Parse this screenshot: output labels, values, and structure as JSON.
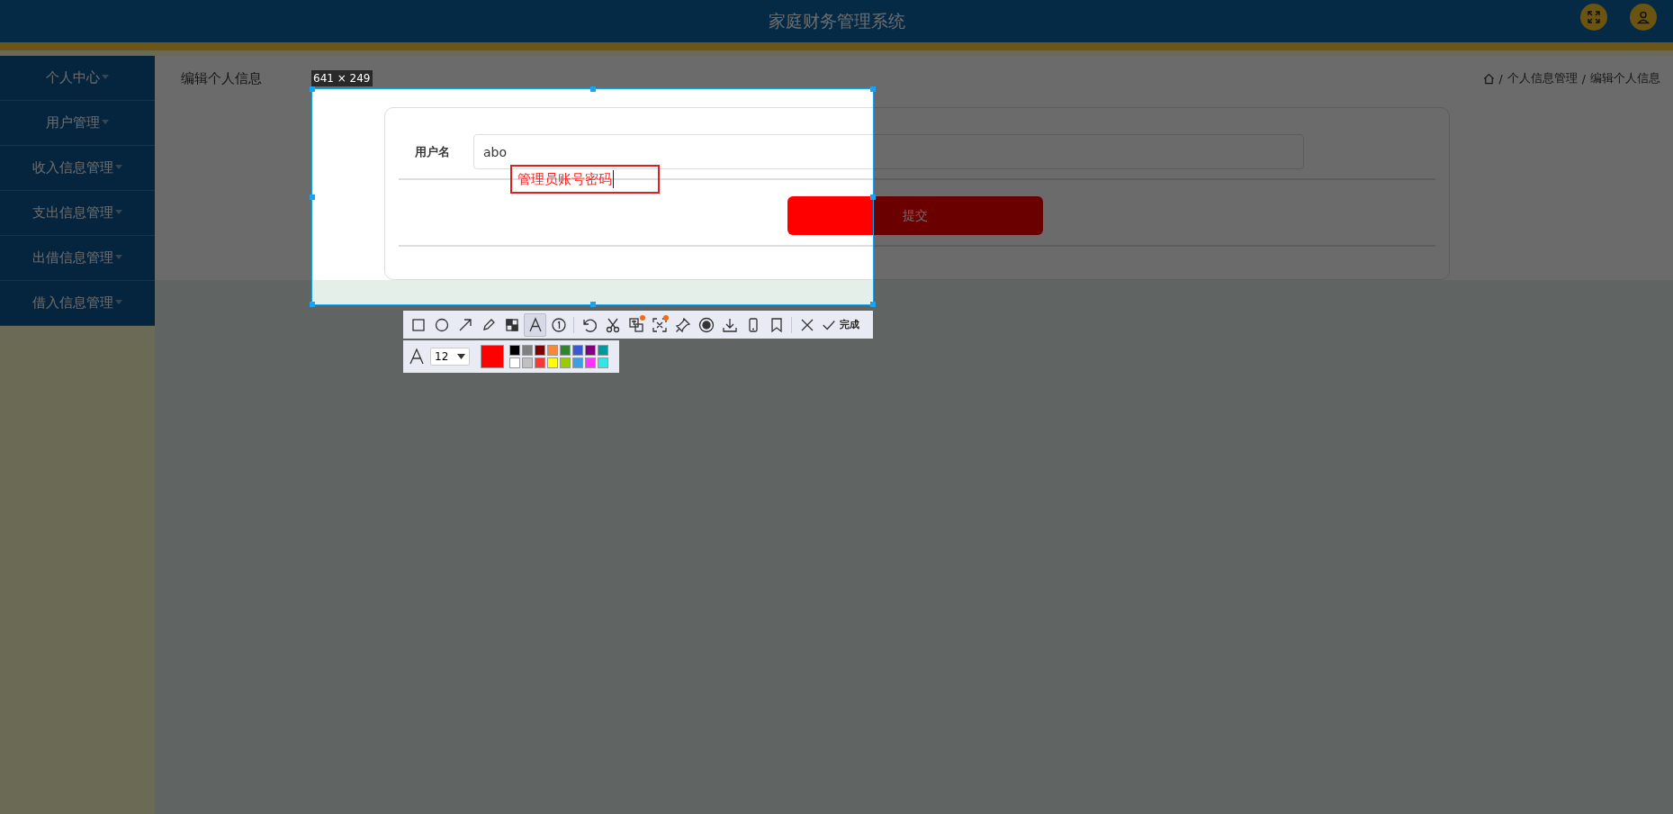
{
  "header": {
    "title": "家庭财务管理系统"
  },
  "sidebar": {
    "items": [
      {
        "label": "个人中心"
      },
      {
        "label": "用户管理"
      },
      {
        "label": "收入信息管理"
      },
      {
        "label": "支出信息管理"
      },
      {
        "label": "出借信息管理"
      },
      {
        "label": "借入信息管理"
      }
    ]
  },
  "page": {
    "title": "编辑个人信息",
    "breadcrumb": [
      "个人信息管理",
      "编辑个人信息"
    ],
    "separator": "/"
  },
  "form": {
    "fields": [
      {
        "label": "用户名",
        "value": "abo"
      }
    ],
    "submit": "提交"
  },
  "capture": {
    "size": "641 × 249",
    "annotation": "管理员账号密码"
  },
  "toolbar": {
    "groups": [
      [
        {
          "selected": false,
          "badge": false
        },
        {
          "selected": false,
          "badge": false
        },
        {
          "selected": false,
          "badge": false
        },
        {
          "selected": false,
          "badge": false
        },
        {
          "selected": false,
          "badge": false
        },
        {
          "selected": true,
          "badge": false
        },
        {
          "selected": false,
          "badge": false
        }
      ],
      [
        {
          "selected": false,
          "badge": false
        },
        {
          "selected": false,
          "badge": false
        },
        {
          "selected": false,
          "badge": true
        },
        {
          "selected": false,
          "badge": true
        },
        {
          "selected": false,
          "badge": false
        },
        {
          "selected": false,
          "badge": false
        },
        {
          "selected": false,
          "badge": false
        },
        {
          "selected": false,
          "badge": false
        },
        {
          "selected": false,
          "badge": false
        }
      ],
      [
        {
          "selected": false,
          "badge": false
        }
      ]
    ],
    "done_label": "完成"
  },
  "text_options": {
    "font_size": "12",
    "color": "#ff0000",
    "palette": [
      {
        "color": "#000000"
      },
      {
        "color": "#808080"
      },
      {
        "color": "#800000"
      },
      {
        "color": "#f7883a"
      },
      {
        "color": "#308430"
      },
      {
        "color": "#385ad3"
      },
      {
        "color": "#800080"
      },
      {
        "color": "#009999"
      },
      {
        "color": "#ffffff"
      },
      {
        "color": "#c0c0c0"
      },
      {
        "color": "#fb3838"
      },
      {
        "color": "#ffff00"
      },
      {
        "color": "#99cc00"
      },
      {
        "color": "#3d9ee5"
      },
      {
        "color": "#ff33ff"
      },
      {
        "color": "#33e6e6"
      }
    ]
  }
}
